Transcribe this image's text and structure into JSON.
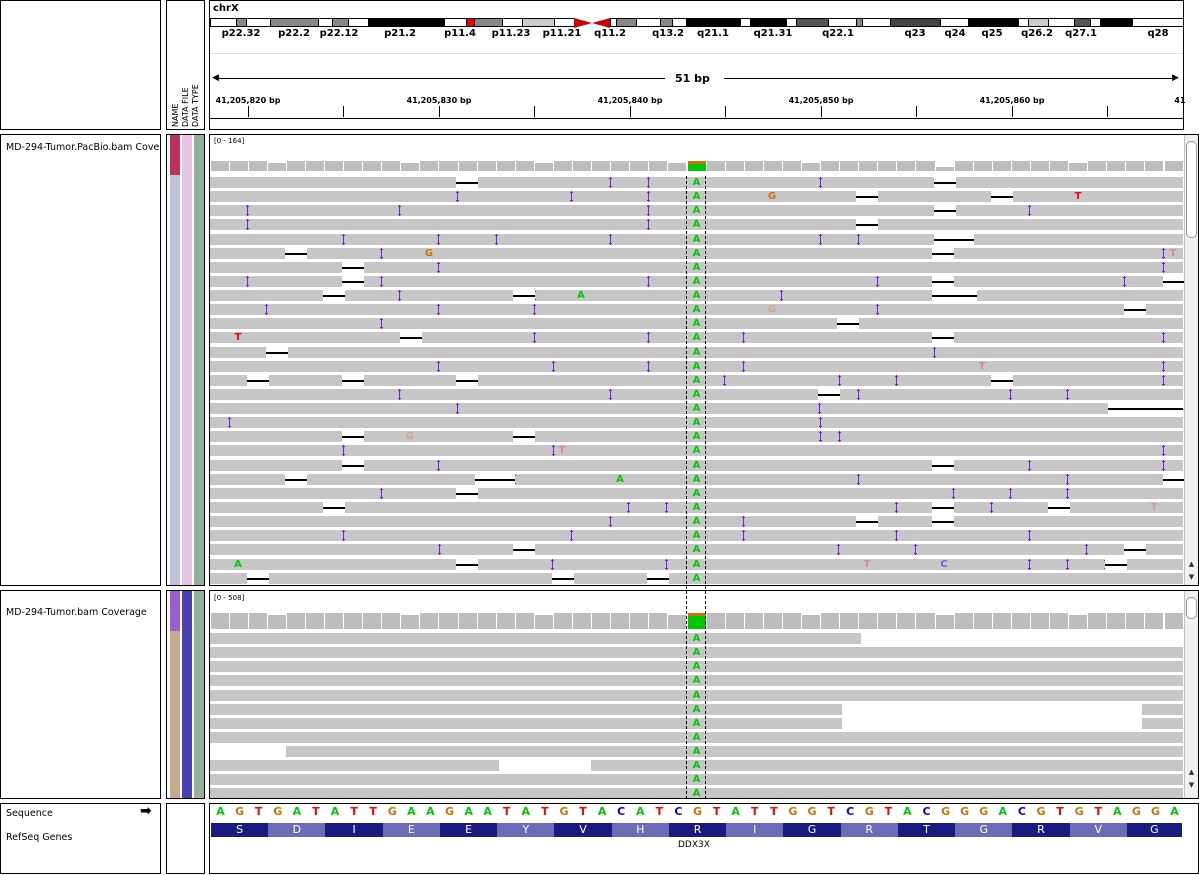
{
  "colors": {
    "A": "#00c800",
    "C": "#0000ff",
    "G": "#d17105",
    "T": "#ff0000",
    "read": "#c6c6c6",
    "insertion": "#7d1fd3",
    "coverage_bar": "#bdbdbd",
    "aa_dark": "#1a1a80",
    "aa_light": "#6b6bb8"
  },
  "header": {
    "chromosome": "chrX",
    "band_labels": [
      "p22.32",
      "p22.2",
      "p22.12",
      "p21.2",
      "p11.4",
      "p11.23",
      "p11.21",
      "q11.2",
      "q13.2",
      "q21.1",
      "q21.31",
      "q22.1",
      "q23",
      "q24",
      "q25",
      "q26.2",
      "q27.1",
      "q28"
    ],
    "span_label": "51 bp",
    "ticks": [
      "41,205,820 bp",
      "41,205,830 bp",
      "41,205,840 bp",
      "41,205,850 bp",
      "41,205,860 bp",
      "41"
    ],
    "attr_labels": [
      "NAME",
      "DATA FILE",
      "DATA TYPE"
    ]
  },
  "tracks": {
    "pacbio": {
      "name": "MD-294-Tumor.PacBio.bam Cove",
      "range": "[0 - 164]"
    },
    "illumina": {
      "name": "MD-294-Tumor.bam Coverage",
      "range": "[0 - 508]"
    },
    "sequence_label": "Sequence",
    "genes_label": "RefSeq Genes",
    "gene_name": "DDX3X"
  },
  "center_base": "A",
  "sequence": [
    "A",
    "G",
    "T",
    "G",
    "A",
    "T",
    "A",
    "T",
    "T",
    "G",
    "A",
    "A",
    "G",
    "A",
    "A",
    "T",
    "A",
    "T",
    "G",
    "T",
    "A",
    "C",
    "A",
    "T",
    "C",
    "G",
    "T",
    "A",
    "T",
    "T",
    "G",
    "G",
    "T",
    "C",
    "G",
    "T",
    "A",
    "C",
    "G",
    "G",
    "G",
    "A",
    "C",
    "G",
    "T",
    "G",
    "T",
    "A",
    "G",
    "G",
    "A"
  ],
  "amino_acids": [
    "S",
    "D",
    "I",
    "E",
    "E",
    "Y",
    "V",
    "H",
    "R",
    "I",
    "G",
    "R",
    "T",
    "G",
    "R",
    "V",
    "G"
  ]
}
